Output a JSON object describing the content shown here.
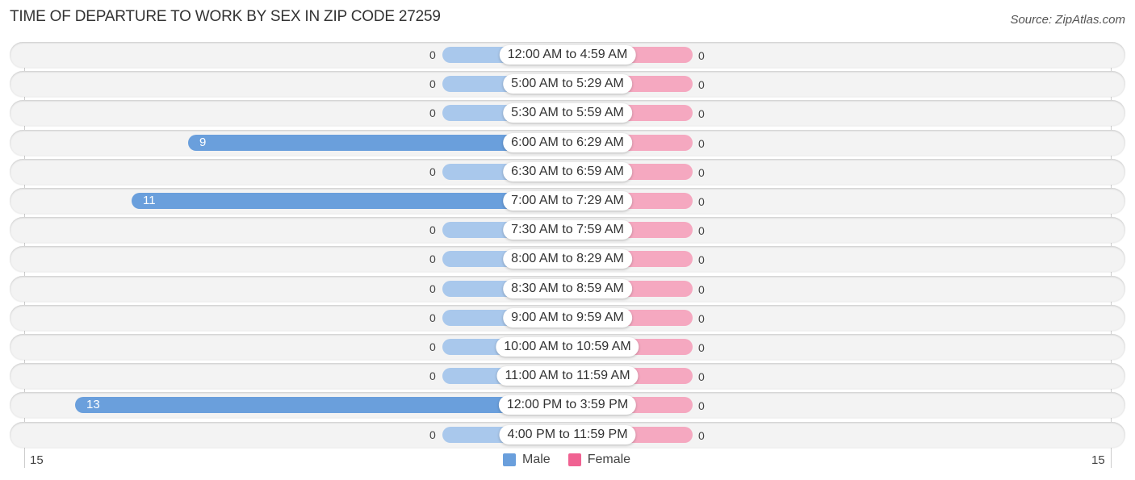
{
  "chart_data": {
    "type": "bar",
    "orientation": "horizontal-diverging",
    "title": "TIME OF DEPARTURE TO WORK BY SEX IN ZIP CODE 27259",
    "source": "Source: ZipAtlas.com",
    "categories": [
      "12:00 AM to 4:59 AM",
      "5:00 AM to 5:29 AM",
      "5:30 AM to 5:59 AM",
      "6:00 AM to 6:29 AM",
      "6:30 AM to 6:59 AM",
      "7:00 AM to 7:29 AM",
      "7:30 AM to 7:59 AM",
      "8:00 AM to 8:29 AM",
      "8:30 AM to 8:59 AM",
      "9:00 AM to 9:59 AM",
      "10:00 AM to 10:59 AM",
      "11:00 AM to 11:59 AM",
      "12:00 PM to 3:59 PM",
      "4:00 PM to 11:59 PM"
    ],
    "series": [
      {
        "name": "Male",
        "color": "#6a9fdc",
        "values": [
          0,
          0,
          0,
          9,
          0,
          11,
          0,
          0,
          0,
          0,
          0,
          0,
          13,
          0
        ]
      },
      {
        "name": "Female",
        "color": "#f06292",
        "values": [
          0,
          0,
          0,
          0,
          0,
          0,
          0,
          0,
          0,
          0,
          0,
          0,
          0,
          0
        ]
      }
    ],
    "axis": {
      "left_tick": "15",
      "right_tick": "15",
      "max": 15
    },
    "legend": {
      "position": "bottom-center",
      "items": [
        "Male",
        "Female"
      ]
    },
    "grid": false
  }
}
